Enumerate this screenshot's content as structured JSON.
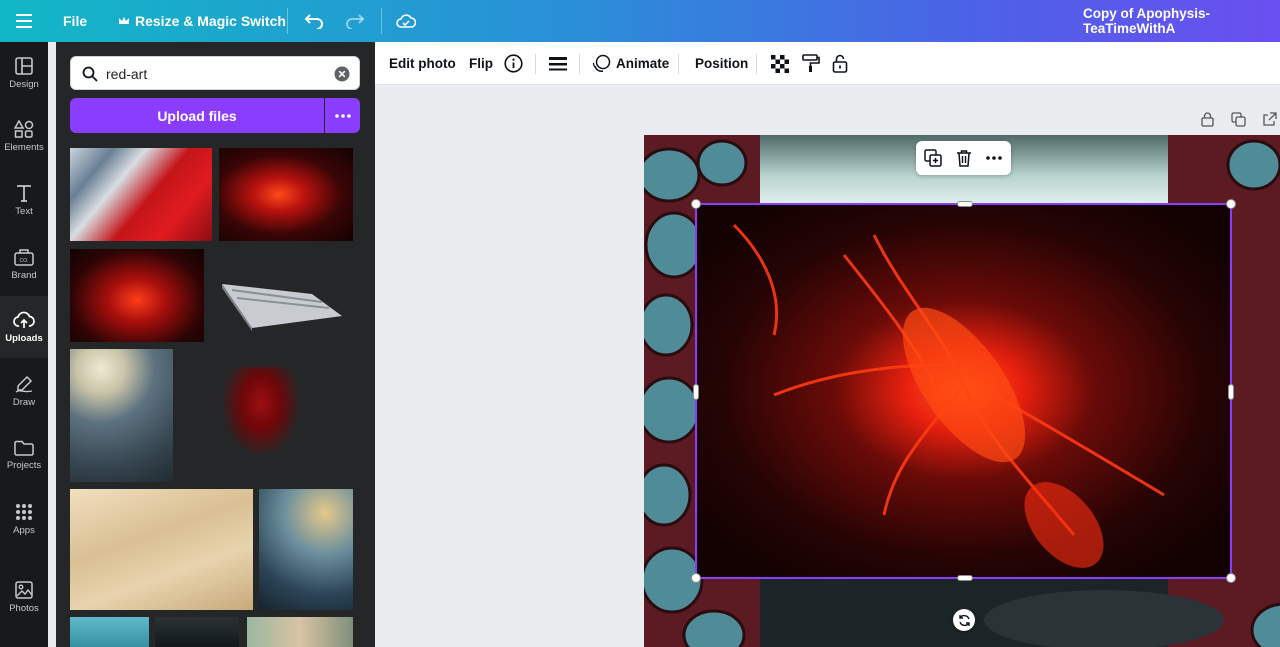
{
  "topbar": {
    "file_label": "File",
    "resize_label": "Resize & Magic Switch",
    "doc_title": "Copy of Apophysis-TeaTimeWithA"
  },
  "rail": {
    "items": [
      {
        "label": "Design",
        "icon": "layout-icon"
      },
      {
        "label": "Elements",
        "icon": "shapes-icon"
      },
      {
        "label": "Text",
        "icon": "text-icon"
      },
      {
        "label": "Brand",
        "icon": "brand-kit-icon"
      },
      {
        "label": "Uploads",
        "icon": "cloud-upload-icon",
        "active": true
      },
      {
        "label": "Draw",
        "icon": "pen-icon"
      },
      {
        "label": "Projects",
        "icon": "folder-icon"
      },
      {
        "label": "Apps",
        "icon": "apps-grid-icon"
      },
      {
        "label": "Photos",
        "icon": "photo-icon"
      }
    ]
  },
  "panel": {
    "search_value": "red-art",
    "upload_label": "Upload files"
  },
  "toolbar": {
    "edit_photo": "Edit photo",
    "flip": "Flip",
    "animate": "Animate",
    "position": "Position"
  },
  "colors": {
    "accent": "#8b3dff",
    "rail_bg": "#18191b",
    "panel_bg": "#252627",
    "canvas_bg": "#ebecf0"
  }
}
